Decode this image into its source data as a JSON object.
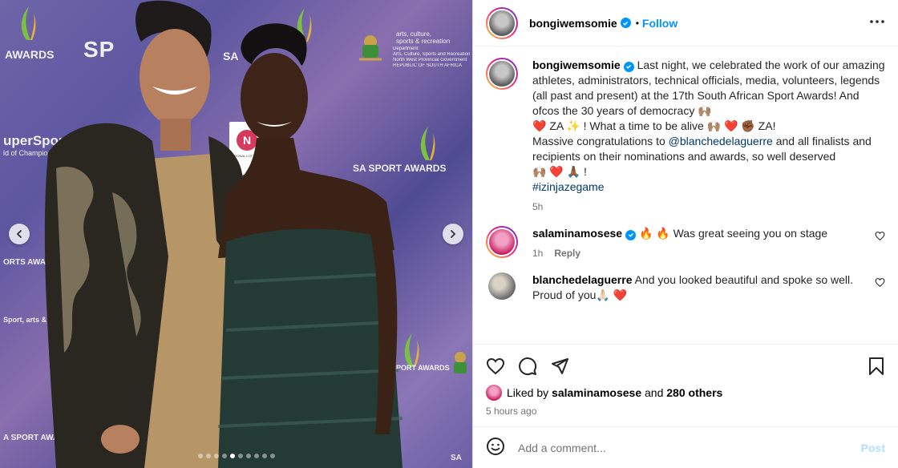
{
  "media": {
    "backdrop": {
      "awards_left": "AWARDS",
      "sp_logo": "SP",
      "sa_left": "SA",
      "supersport": "uperSport",
      "champions": "ld of Champions",
      "sa_sport_awards": "SA SPORT AWARDS",
      "orts_awards": "ORTS AWARDS",
      "sport_awards_bottom": "SPORT AWARDS",
      "sa_sport_bottom": "A SPORT AWAR",
      "sa_right_bottom": "SA",
      "dept_line1": "arts, culture,",
      "dept_line2": "sports & recreation",
      "dept_line3": "Department:",
      "dept_line4": "Arts, Culture, Sports and Recreation",
      "dept_line5": "North West Provincial Government",
      "dept_line6": "REPUBLIC OF SOUTH AFRICA",
      "sportarts": "Sport, arts &",
      "national_banner": "NATIONAL LOTTERIES"
    },
    "dots_count": 10,
    "active_dot": 4
  },
  "post": {
    "author": {
      "username": "bongiwemsomie",
      "follow_label": "Follow",
      "separator": "•"
    },
    "caption": {
      "username": "bongiwemsomie",
      "text_part1": "Last night, we celebrated the work of our amazing athletes, administrators, technical officials, media, volunteers, legends (all past and present) at the 17th South African Sport Awards! And ofcos the 30 years of democracy 🙌🏽",
      "text_part2": "❤️ ZA ✨ ! What a time to be alive 🙌🏽 ❤️ ✊🏾 ZA!",
      "text_part3a": "Massive congratulations to ",
      "mention": "@blanchedelaguerre",
      "text_part3b": " and all finalists and recipients on their nominations and awards, so well deserved",
      "text_part4": "🙌🏽 ❤️ 🙏🏾 !",
      "hashtag": "#izinjazegame",
      "time": "5h"
    },
    "comments": [
      {
        "username": "salaminamosese",
        "text": "🔥 🔥 Was great seeing you on stage",
        "time": "1h",
        "reply_label": "Reply"
      },
      {
        "username": "blanchedelaguerre",
        "text": "And you looked beautiful and spoke so well. Proud of you🙏🏻 ❤️"
      }
    ],
    "likes": {
      "prefix": "Liked by ",
      "user": "salaminamosese",
      "middle": " and ",
      "others": "280 others"
    },
    "posted_time": "5 hours ago",
    "add_comment": {
      "placeholder": "Add a comment...",
      "post_label": "Post"
    }
  },
  "colors": {
    "accent": "#0095f6",
    "verified": "#0095f6",
    "link": "#00376b",
    "muted": "#737373",
    "post_disabled": "#b2dffc"
  }
}
